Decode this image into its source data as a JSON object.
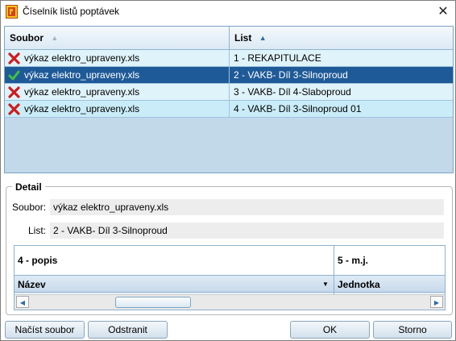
{
  "window": {
    "title": "Číselník listů poptávek",
    "close_glyph": "✕"
  },
  "grid": {
    "headers": {
      "soubor": "Soubor",
      "list": "List"
    },
    "sort_glyphs": {
      "soubor": "▲",
      "list": "▲"
    },
    "rows": [
      {
        "status_icon": "red-x-icon",
        "soubor": "výkaz elektro_upraveny.xls",
        "list": "1 - REKAPITULACE"
      },
      {
        "status_icon": "green-check-icon",
        "soubor": "výkaz elektro_upraveny.xls",
        "list": "2 - VAKB- Díl 3-Silnoproud"
      },
      {
        "status_icon": "red-x-icon",
        "soubor": "výkaz elektro_upraveny.xls",
        "list": "3 - VAKB- Díl 4-Slaboproud"
      },
      {
        "status_icon": "red-x-icon",
        "soubor": "výkaz elektro_upraveny.xls",
        "list": "4 - VAKB- Díl 3-Silnoproud 01"
      }
    ]
  },
  "detail": {
    "legend": "Detail",
    "soubor_label": "Soubor:",
    "soubor_value": "výkaz elektro_upraveny.xls",
    "list_label": "List:",
    "list_value": "2 - VAKB- Díl 3-Silnoproud",
    "mapping": {
      "col1_header": "4 - popis",
      "col2_header": "5 - m.j.",
      "col1_field": "Název",
      "col2_field": "Jednotka",
      "dropdown_glyph": "▼",
      "scroll_left_glyph": "◀",
      "scroll_right_glyph": "▶"
    }
  },
  "buttons": {
    "load": "Načíst soubor",
    "remove": "Odstranit",
    "ok": "OK",
    "cancel": "Storno"
  },
  "colors": {
    "selected_row": "#1f5a98",
    "grid_bg": "#c2d9e9",
    "accent": "#2e6aa8"
  }
}
